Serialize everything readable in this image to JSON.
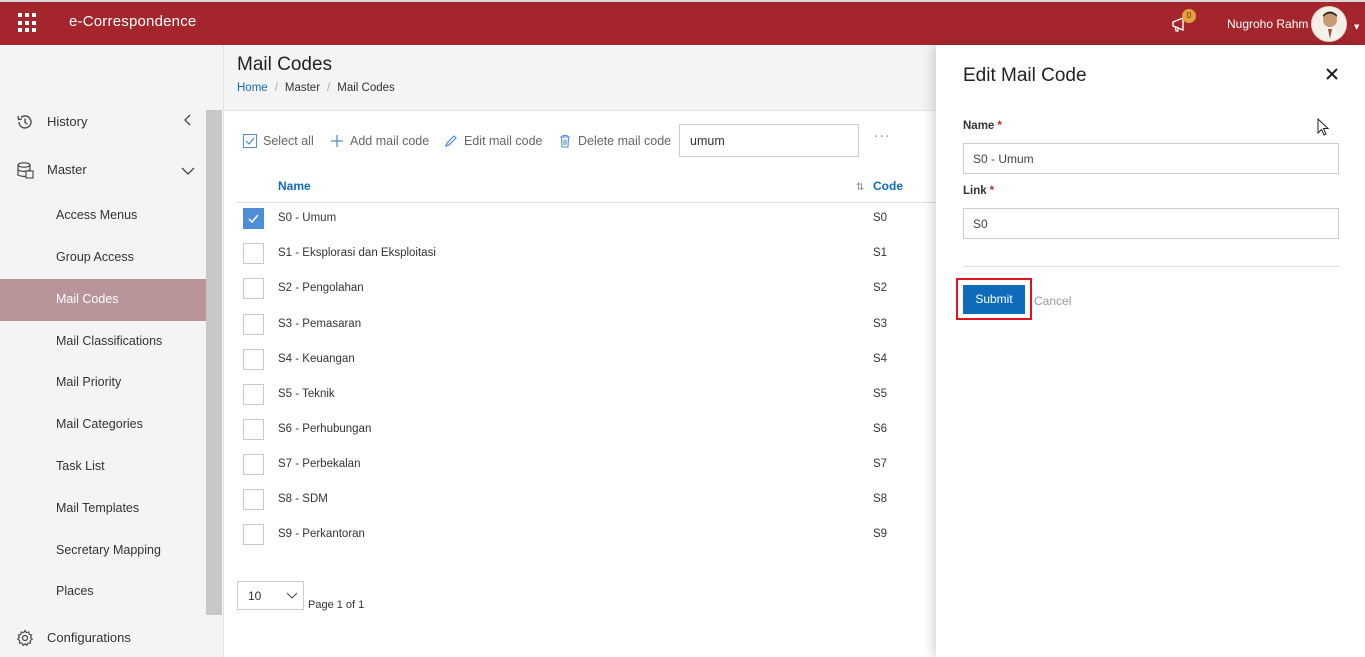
{
  "app": {
    "title": "e-Correspondence",
    "notification_count": "0",
    "user_name": "Nugroho Rahm"
  },
  "page": {
    "title": "Mail Codes",
    "breadcrumb": [
      "Home",
      "Master",
      "Mail Codes"
    ]
  },
  "sidebar": {
    "history_label": "History",
    "master_label": "Master",
    "items": [
      {
        "label": "Access Menus"
      },
      {
        "label": "Group Access"
      },
      {
        "label": "Mail Codes",
        "active": true
      },
      {
        "label": "Mail Classifications"
      },
      {
        "label": "Mail Priority"
      },
      {
        "label": "Mail Categories"
      },
      {
        "label": "Task List"
      },
      {
        "label": "Mail Templates"
      },
      {
        "label": "Secretary Mapping"
      },
      {
        "label": "Places"
      }
    ],
    "configurations_label": "Configurations"
  },
  "toolbar": {
    "select_all": "Select all",
    "add": "Add mail code",
    "edit": "Edit mail code",
    "delete": "Delete mail code",
    "search_value": "umum"
  },
  "table": {
    "columns": [
      "Name",
      "Code"
    ],
    "rows": [
      {
        "name": "S0 - Umum",
        "code": "S0",
        "checked": true
      },
      {
        "name": "S1 - Eksplorasi dan Eksploitasi",
        "code": "S1"
      },
      {
        "name": "S2 - Pengolahan",
        "code": "S2"
      },
      {
        "name": "S3 - Pemasaran",
        "code": "S3"
      },
      {
        "name": "S4 - Keuangan",
        "code": "S4"
      },
      {
        "name": "S5 - Teknik",
        "code": "S5"
      },
      {
        "name": "S6 - Perhubungan",
        "code": "S6"
      },
      {
        "name": "S7 - Perbekalan",
        "code": "S7"
      },
      {
        "name": "S8 - SDM",
        "code": "S8"
      },
      {
        "name": "S9 - Perkantoran",
        "code": "S9"
      }
    ]
  },
  "pager": {
    "page_size": "10",
    "page_text": "Page 1 of 1"
  },
  "panel": {
    "title": "Edit Mail Code",
    "name_label": "Name",
    "name_value": "S0 - Umum",
    "link_label": "Link",
    "link_value": "S0",
    "required_mark": "*",
    "submit": "Submit",
    "cancel": "Cancel"
  },
  "colors": {
    "brand": "#a4262c",
    "accent": "#0f6cbd",
    "active_item": "#b99498",
    "highlight": "#e1141c"
  }
}
